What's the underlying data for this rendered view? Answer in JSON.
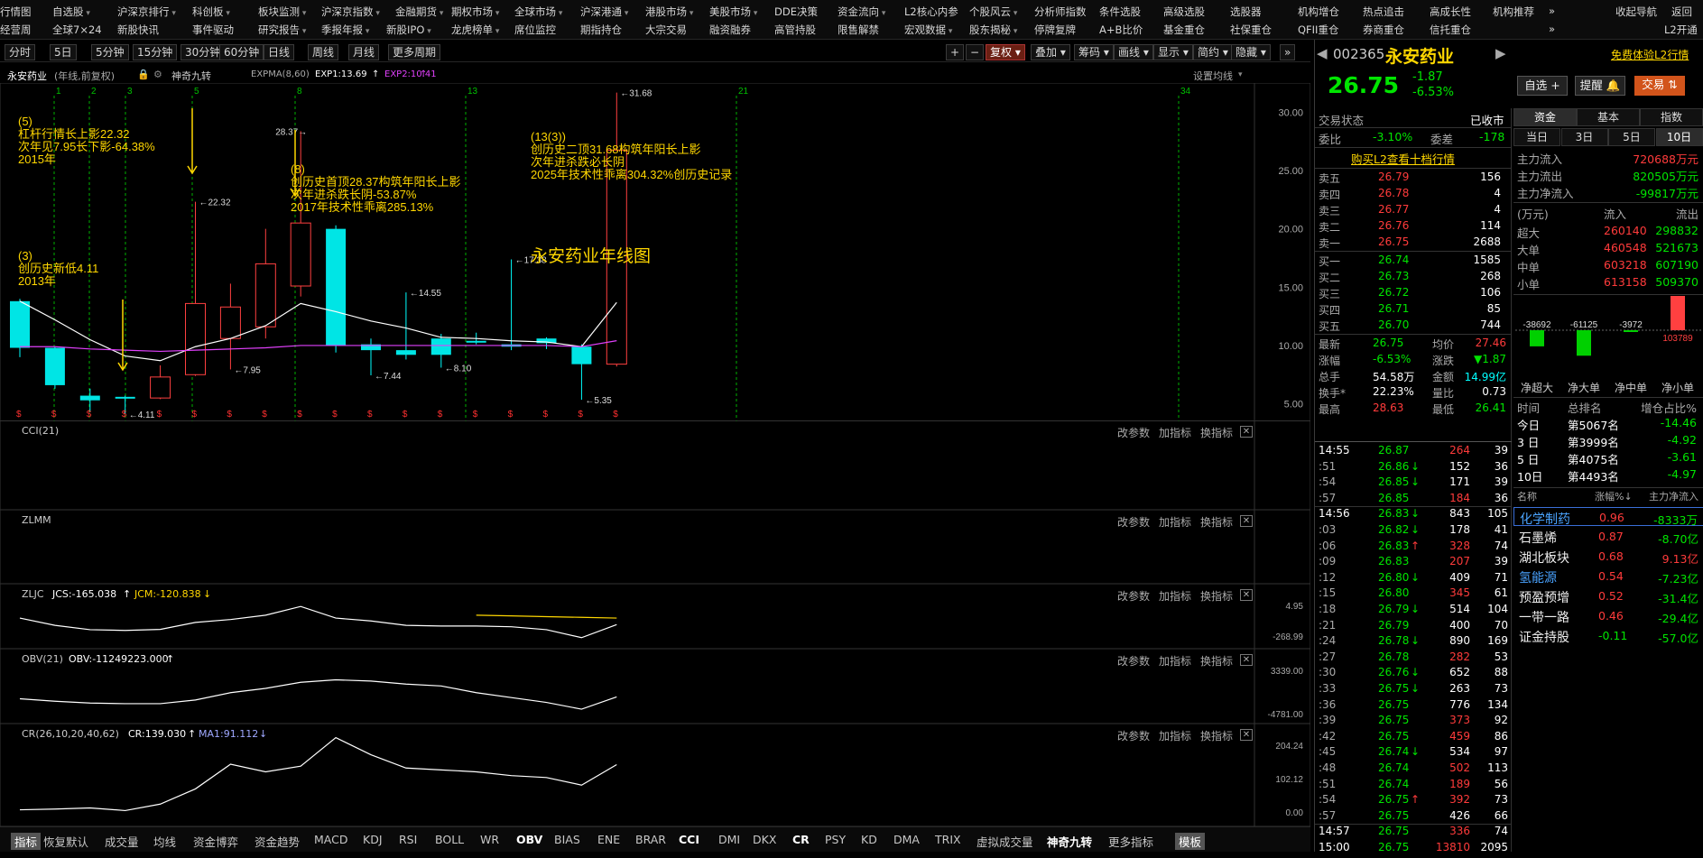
{
  "menu_row1": [
    {
      "label": "行情图",
      "arrow": false
    },
    {
      "label": "自选股",
      "arrow": true
    },
    {
      "label": "沪深京排行",
      "arrow": true
    },
    {
      "label": "科创板",
      "arrow": true
    },
    {
      "label": "板块监测",
      "arrow": true
    },
    {
      "label": "沪深京指数",
      "arrow": true
    },
    {
      "label": "金融期货",
      "arrow": true
    },
    {
      "label": "期权市场",
      "arrow": true
    },
    {
      "label": "全球市场",
      "arrow": true
    },
    {
      "label": "沪深港通",
      "arrow": true
    },
    {
      "label": "港股市场",
      "arrow": true
    },
    {
      "label": "美股市场",
      "arrow": true
    },
    {
      "label": "DDE决策",
      "arrow": false
    },
    {
      "label": "资金流向",
      "arrow": true
    },
    {
      "label": "L2核心内参",
      "arrow": false
    },
    {
      "label": "个股风云",
      "arrow": true
    },
    {
      "label": "分析师指数",
      "arrow": false
    },
    {
      "label": "条件选股",
      "arrow": false
    },
    {
      "label": "高级选股",
      "arrow": false
    },
    {
      "label": "选股器",
      "arrow": false
    },
    {
      "label": "机构增仓",
      "arrow": false
    },
    {
      "label": "热点追击",
      "arrow": false
    },
    {
      "label": "高成长性",
      "arrow": false
    },
    {
      "label": "机构推荐",
      "arrow": false
    },
    {
      "label": "»",
      "arrow": false
    },
    {
      "label": "收起导航",
      "arrow": false
    },
    {
      "label": "返回",
      "arrow": false
    }
  ],
  "menu_row2": [
    {
      "label": "经营周",
      "arrow": false
    },
    {
      "label": "全球7×24",
      "arrow": false
    },
    {
      "label": "新股快讯",
      "arrow": false
    },
    {
      "label": "事件驱动",
      "arrow": false
    },
    {
      "label": "研究报告",
      "arrow": true
    },
    {
      "label": "季报年报",
      "arrow": true
    },
    {
      "label": "新股IPO",
      "arrow": true
    },
    {
      "label": "龙虎榜单",
      "arrow": true
    },
    {
      "label": "席位监控",
      "arrow": false
    },
    {
      "label": "期指持仓",
      "arrow": false
    },
    {
      "label": "大宗交易",
      "arrow": false
    },
    {
      "label": "融资融券",
      "arrow": false
    },
    {
      "label": "高管持股",
      "arrow": false
    },
    {
      "label": "限售解禁",
      "arrow": false
    },
    {
      "label": "宏观数据",
      "arrow": true
    },
    {
      "label": "股东揭秘",
      "arrow": true
    },
    {
      "label": "停牌复牌",
      "arrow": false
    },
    {
      "label": "A+B比价",
      "arrow": false
    },
    {
      "label": "基金重仓",
      "arrow": false
    },
    {
      "label": "社保重仓",
      "arrow": false
    },
    {
      "label": "QFII重仓",
      "arrow": false
    },
    {
      "label": "券商重仓",
      "arrow": false
    },
    {
      "label": "信托重仓",
      "arrow": false
    },
    {
      "label": "»",
      "arrow": false
    },
    {
      "label": "L2开通",
      "arrow": false
    }
  ],
  "toolbar_left": [
    "分时",
    "5日",
    "5分钟",
    "15分钟",
    "30分钟",
    "60分钟",
    "日线",
    "周线",
    "月线",
    "更多周期"
  ],
  "toolbar_right": [
    "+",
    "−",
    "复权",
    "叠加",
    "筹码",
    "画线",
    "显示",
    "简约",
    "隐藏",
    "»"
  ],
  "main_panel": {
    "stock_name": "永安药业",
    "cycle": "(年线,前复权)",
    "indicator_name": "神奇九转",
    "ema_label": "EXPMA(8,60)",
    "exp1": "EXP1:13.69",
    "exp2": "EXP2:10.41",
    "settings": "设置均线",
    "chart_title": "永安药业年线图",
    "annotations": [
      {
        "id": "a5",
        "lines": [
          "(5)",
          "杠杆行情长上影22.32",
          "次年见7.95长下影-64.38%",
          "2015年"
        ]
      },
      {
        "id": "a3",
        "lines": [
          "(3)",
          "创历史新低4.11",
          "2013年"
        ]
      },
      {
        "id": "a8",
        "lines": [
          "(8)",
          "创历史首顶28.37构筑年阳长上影",
          "次年进杀跌长阴-53.87%",
          "2017年技术性乖离285.13%"
        ]
      },
      {
        "id": "a13",
        "lines": [
          "(13(3))",
          "创历史二顶31.68构筑年阳长上影",
          "次年进杀跌必长阴",
          "2025年技术性乖离304.32%创历史记录"
        ]
      }
    ],
    "price_labels": [
      "31.68",
      "28.37",
      "22.32",
      "17.38",
      "14.55",
      "8.10",
      "7.95",
      "7.44",
      "5.35",
      "4.11"
    ],
    "seq_numbers": [
      "1",
      "2",
      "3",
      "5",
      "8",
      "13",
      "21",
      "34"
    ]
  },
  "chart_data": [
    {
      "type": "candlestick",
      "title": "永安药业年线图",
      "ylabel": "",
      "yticks": [
        5.0,
        10.0,
        15.0,
        20.0,
        25.0,
        30.0
      ],
      "ylim": [
        3.5,
        32.5
      ],
      "candles": [
        {
          "open": 13.8,
          "close": 9.8,
          "high": 14.0,
          "low": 9.0
        },
        {
          "open": 9.8,
          "close": 6.6,
          "high": 9.9,
          "low": 6.3
        },
        {
          "open": 5.7,
          "close": 5.3,
          "high": 6.3,
          "low": 4.3
        },
        {
          "open": 5.6,
          "close": 5.5,
          "high": 5.7,
          "low": 4.11
        },
        {
          "open": 5.5,
          "close": 7.3,
          "high": 8.3,
          "low": 5.4
        },
        {
          "open": 7.5,
          "close": 13.6,
          "high": 22.32,
          "low": 7.4
        },
        {
          "open": 10.6,
          "close": 13.3,
          "high": 15.3,
          "low": 7.95
        },
        {
          "open": 11.6,
          "close": 17.0,
          "high": 20.0,
          "low": 10.6
        },
        {
          "open": 15.1,
          "close": 20.5,
          "high": 28.37,
          "low": 14.2
        },
        {
          "open": 20.0,
          "close": 10.0,
          "high": 20.3,
          "low": 9.4
        },
        {
          "open": 10.1,
          "close": 9.6,
          "high": 10.6,
          "low": 7.44
        },
        {
          "open": 9.6,
          "close": 9.2,
          "high": 14.55,
          "low": 8.8
        },
        {
          "open": 10.6,
          "close": 9.2,
          "high": 11.0,
          "low": 8.1
        },
        {
          "open": 10.4,
          "close": 10.3,
          "high": 11.1,
          "low": 10.1
        },
        {
          "open": 10.1,
          "close": 9.9,
          "high": 17.38,
          "low": 9.6
        },
        {
          "open": 10.6,
          "close": 10.2,
          "high": 10.7,
          "low": 9.7
        },
        {
          "open": 9.9,
          "close": 8.4,
          "high": 10.1,
          "low": 5.35
        },
        {
          "open": 8.4,
          "close": 26.75,
          "high": 31.68,
          "low": 8.2
        }
      ],
      "exp1": [
        13.8,
        12.2,
        10.5,
        9.1,
        8.7,
        9.9,
        10.6,
        11.7,
        13.6,
        12.9,
        12.1,
        11.5,
        10.7,
        10.6,
        10.4,
        10.3,
        9.9,
        13.69
      ],
      "exp2": [
        9.9,
        9.9,
        9.7,
        9.6,
        9.5,
        9.6,
        9.7,
        9.8,
        10.0,
        10.0,
        10.0,
        10.0,
        10.0,
        10.0,
        10.0,
        10.0,
        9.9,
        10.41
      ]
    },
    {
      "type": "line",
      "name": "ZLJC",
      "series": [
        {
          "name": "JCS",
          "values": [
            -120,
            -170,
            -200,
            -205,
            -198,
            -150,
            -130,
            -100,
            -40,
            -120,
            -140,
            -170,
            -175,
            -175,
            -180,
            -200,
            -255,
            -165
          ]
        },
        {
          "name": "JCM",
          "values": [
            null,
            null,
            null,
            null,
            null,
            null,
            null,
            null,
            null,
            null,
            null,
            null,
            null,
            -100,
            -105,
            -110,
            -115,
            -120
          ]
        }
      ],
      "yticks": [
        4.95,
        -268.99
      ]
    },
    {
      "type": "line",
      "name": "OBV",
      "series": [
        {
          "name": "OBV",
          "values": [
            -2200,
            -2600,
            -2900,
            -3000,
            -3000,
            -2400,
            -1200,
            -500,
            500,
            900,
            700,
            200,
            -100,
            -1200,
            -2000,
            -2800,
            -3900,
            -1900
          ]
        }
      ],
      "yticks": [
        3339.0,
        -4781.0
      ]
    },
    {
      "type": "line",
      "name": "CR",
      "series": [
        {
          "name": "CR",
          "values": [
            20,
            22,
            25,
            18,
            35,
            75,
            140,
            120,
            135,
            210,
            165,
            130,
            125,
            120,
            110,
            105,
            85,
            139
          ]
        }
      ],
      "yticks": [
        204.24,
        102.12,
        0.0
      ]
    }
  ],
  "subpanels": {
    "cci": {
      "label": "CCI(21)"
    },
    "zlmm": {
      "label": "ZLMM"
    },
    "zljc": {
      "label": "ZLJC",
      "v1": "JCS:-165.038",
      "v2": "JCM:-120.838",
      "hi": "4.95",
      "lo": "-268.99"
    },
    "obv": {
      "label": "OBV(21)",
      "v1": "OBV:-11249223.000",
      "hi": "3339.00",
      "lo": "-4781.00"
    },
    "cr": {
      "label": "CR(26,10,20,40,62)",
      "v1": "CR:139.030",
      "v2": "MA1:91.112",
      "hi": "204.24",
      "mid": "102.12",
      "lo": "0.00"
    },
    "buttons": [
      "改参数",
      "加指标",
      "换指标"
    ]
  },
  "bottom_tabs": [
    "指标",
    "恢复默认",
    "成交量",
    "均线",
    "资金博弈",
    "资金趋势",
    "MACD",
    "KDJ",
    "RSI",
    "BOLL",
    "WR",
    "OBV",
    "BIAS",
    "ENE",
    "BRAR",
    "CCI",
    "DMI",
    "DKX",
    "CR",
    "PSY",
    "KD",
    "DMA",
    "TRIX",
    "虚拟成交量",
    "神奇九转",
    "更多指标",
    "模板"
  ],
  "quote": {
    "code": "002365",
    "name": "永安药业",
    "l2_link": "免费体验L2行情",
    "price": "26.75",
    "change": "-1.87",
    "change_pct": "-6.53%",
    "btn_watch": "自选 +",
    "btn_alert": "提醒",
    "btn_trade": "交易",
    "status_label": "交易状态",
    "status": "已收市",
    "wb_label": "委比",
    "wb": "-3.10%",
    "wc_label": "委差",
    "wc": "-178",
    "l2_buy": "购买L2查看十档行情",
    "asks": [
      {
        "label": "卖五",
        "price": "26.79",
        "vol": "156"
      },
      {
        "label": "卖四",
        "price": "26.78",
        "vol": "4"
      },
      {
        "label": "卖三",
        "price": "26.77",
        "vol": "4"
      },
      {
        "label": "卖二",
        "price": "26.76",
        "vol": "114"
      },
      {
        "label": "卖一",
        "price": "26.75",
        "vol": "2688"
      }
    ],
    "bids": [
      {
        "label": "买一",
        "price": "26.74",
        "vol": "1585"
      },
      {
        "label": "买二",
        "price": "26.73",
        "vol": "268"
      },
      {
        "label": "买三",
        "price": "26.72",
        "vol": "106"
      },
      {
        "label": "买四",
        "price": "26.71",
        "vol": "85"
      },
      {
        "label": "买五",
        "price": "26.70",
        "vol": "744"
      }
    ],
    "stats": [
      {
        "l1": "最新",
        "v1": "26.75",
        "c1": "green",
        "l2": "均价",
        "v2": "27.46",
        "c2": "red"
      },
      {
        "l1": "涨幅",
        "v1": "-6.53%",
        "c1": "green",
        "l2": "涨跌",
        "v2": "▼1.87",
        "c2": "green"
      },
      {
        "l1": "总手",
        "v1": "54.58万",
        "c1": "white",
        "l2": "金额",
        "v2": "14.99亿",
        "c2": "cyan"
      },
      {
        "l1": "换手*",
        "v1": "22.23%",
        "c1": "white",
        "l2": "量比",
        "v2": "0.73",
        "c2": "white"
      },
      {
        "l1": "最高",
        "v1": "28.63",
        "c1": "red",
        "l2": "最低",
        "v2": "26.41",
        "c2": "green"
      }
    ]
  },
  "ticks": [
    {
      "t": "14:55",
      "p": "26.87",
      "v": "264",
      "n": "39",
      "arrow": "",
      "bold": true,
      "vc": "red"
    },
    {
      "t": ":51",
      "p": "26.86",
      "v": "152",
      "n": "36",
      "arrow": "down",
      "vc": "white"
    },
    {
      "t": ":54",
      "p": "26.85",
      "v": "171",
      "n": "39",
      "arrow": "down",
      "vc": "white"
    },
    {
      "t": ":57",
      "p": "26.85",
      "v": "184",
      "n": "36",
      "arrow": "",
      "vc": "red"
    },
    {
      "t": "14:56",
      "p": "26.83",
      "v": "843",
      "n": "105",
      "arrow": "down",
      "bold": true,
      "vc": "white"
    },
    {
      "t": ":03",
      "p": "26.82",
      "v": "178",
      "n": "41",
      "arrow": "down",
      "vc": "white"
    },
    {
      "t": ":06",
      "p": "26.83",
      "v": "328",
      "n": "74",
      "arrow": "up",
      "vc": "red"
    },
    {
      "t": ":09",
      "p": "26.83",
      "v": "207",
      "n": "39",
      "arrow": "",
      "vc": "red"
    },
    {
      "t": ":12",
      "p": "26.80",
      "v": "409",
      "n": "71",
      "arrow": "down",
      "vc": "white"
    },
    {
      "t": ":15",
      "p": "26.80",
      "v": "345",
      "n": "61",
      "arrow": "",
      "vc": "red"
    },
    {
      "t": ":18",
      "p": "26.79",
      "v": "514",
      "n": "104",
      "arrow": "down",
      "vc": "white"
    },
    {
      "t": ":21",
      "p": "26.79",
      "v": "400",
      "n": "70",
      "arrow": "",
      "vc": "white"
    },
    {
      "t": ":24",
      "p": "26.78",
      "v": "890",
      "n": "169",
      "arrow": "down",
      "vc": "white"
    },
    {
      "t": ":27",
      "p": "26.78",
      "v": "282",
      "n": "53",
      "arrow": "",
      "vc": "red"
    },
    {
      "t": ":30",
      "p": "26.76",
      "v": "652",
      "n": "88",
      "arrow": "down",
      "vc": "white"
    },
    {
      "t": ":33",
      "p": "26.75",
      "v": "263",
      "n": "73",
      "arrow": "down",
      "vc": "white"
    },
    {
      "t": ":36",
      "p": "26.75",
      "v": "776",
      "n": "134",
      "arrow": "",
      "vc": "white"
    },
    {
      "t": ":39",
      "p": "26.75",
      "v": "373",
      "n": "92",
      "arrow": "",
      "vc": "red"
    },
    {
      "t": ":42",
      "p": "26.75",
      "v": "459",
      "n": "86",
      "arrow": "",
      "vc": "red"
    },
    {
      "t": ":45",
      "p": "26.74",
      "v": "534",
      "n": "97",
      "arrow": "down",
      "vc": "white"
    },
    {
      "t": ":48",
      "p": "26.74",
      "v": "502",
      "n": "113",
      "arrow": "",
      "vc": "red"
    },
    {
      "t": ":51",
      "p": "26.74",
      "v": "189",
      "n": "56",
      "arrow": "",
      "vc": "red"
    },
    {
      "t": ":54",
      "p": "26.75",
      "v": "392",
      "n": "73",
      "arrow": "up",
      "vc": "red"
    },
    {
      "t": ":57",
      "p": "26.75",
      "v": "426",
      "n": "66",
      "arrow": "",
      "vc": "white"
    },
    {
      "t": "14:57",
      "p": "26.75",
      "v": "336",
      "n": "74",
      "arrow": "",
      "bold": true,
      "vc": "red"
    },
    {
      "t": "15:00",
      "p": "26.75",
      "v": "13810",
      "n": "2095",
      "arrow": "",
      "bold": true,
      "vc": "red"
    }
  ],
  "fund": {
    "tabs": [
      "资金",
      "基本",
      "指数"
    ],
    "period_tabs": [
      "当日",
      "3日",
      "5日",
      "10日"
    ],
    "rows": [
      {
        "label": "主力流入",
        "val": "720688万元",
        "c": "red"
      },
      {
        "label": "主力流出",
        "val": "820505万元",
        "c": "green"
      },
      {
        "label": "主力净流入",
        "val": "-99817万元",
        "c": "green"
      }
    ],
    "table_header": [
      "(万元)",
      "流入",
      "流出"
    ],
    "table": [
      {
        "label": "超大",
        "in": "260140",
        "out": "298832"
      },
      {
        "label": "大单",
        "in": "460548",
        "out": "521673"
      },
      {
        "label": "中单",
        "in": "603218",
        "out": "607190"
      },
      {
        "label": "小单",
        "in": "613158",
        "out": "509370"
      }
    ],
    "net_chart": {
      "labels": [
        "净超大",
        "净大单",
        "净中单",
        "净小单"
      ],
      "values": [
        -38692,
        -61125,
        -3972,
        103789
      ],
      "value_labels": [
        "-38692",
        "-61125",
        "-3972",
        "103789"
      ]
    },
    "rank_header": [
      "时间",
      "总排名",
      "增仓占比%"
    ],
    "ranks": [
      {
        "period": "今日",
        "rank": "第5067名",
        "pct": "-14.46"
      },
      {
        "period": "3 日",
        "rank": "第3999名",
        "pct": "-4.92"
      },
      {
        "period": "5 日",
        "rank": "第4075名",
        "pct": "-3.61"
      },
      {
        "period": "10日",
        "rank": "第4493名",
        "pct": "-4.97"
      }
    ],
    "sector_header": [
      "名称",
      "涨幅%↓",
      "主力净流入"
    ],
    "sectors": [
      {
        "name": "化学制药",
        "chg": "0.96",
        "flow": "-8333万",
        "sel": true
      },
      {
        "name": "石墨烯",
        "chg": "0.87",
        "flow": "-8.70亿"
      },
      {
        "name": "湖北板块",
        "chg": "0.68",
        "flow": "9.13亿"
      },
      {
        "name": "氢能源",
        "chg": "0.54",
        "flow": "-7.23亿"
      },
      {
        "name": "预盈预增",
        "chg": "0.52",
        "flow": "-31.4亿"
      },
      {
        "name": "一带一路",
        "chg": "0.46",
        "flow": "-29.4亿"
      },
      {
        "name": "证金持股",
        "chg": "-0.11",
        "flow": "-57.0亿"
      }
    ]
  }
}
